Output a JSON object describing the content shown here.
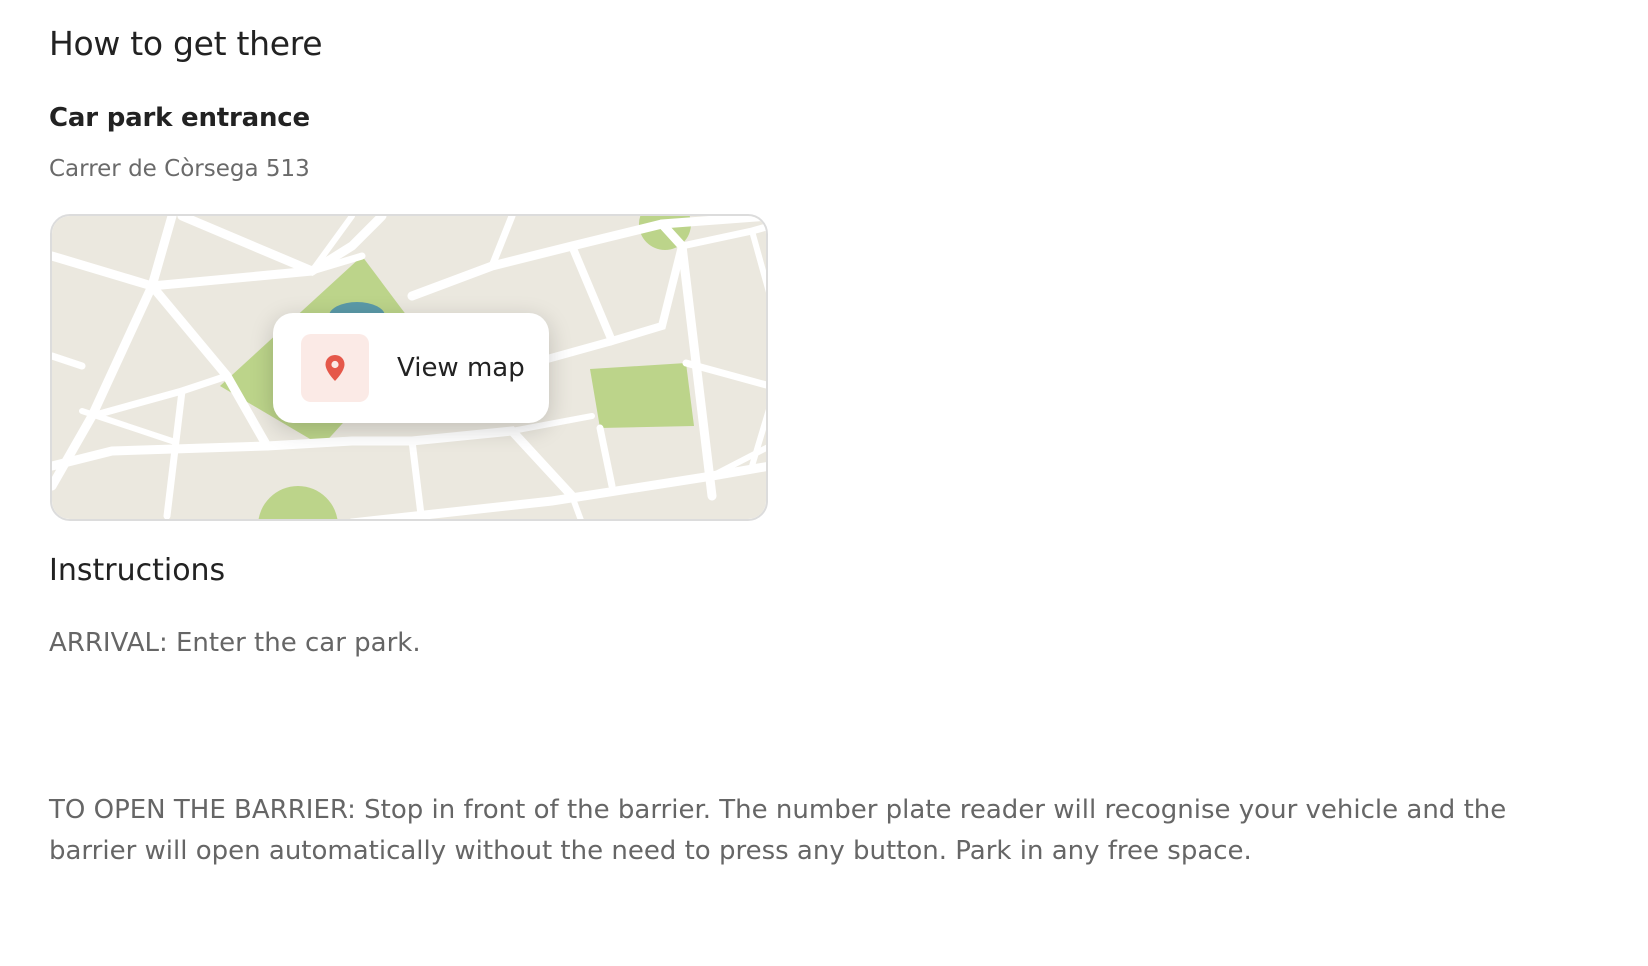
{
  "section": {
    "title": "How to get there"
  },
  "location": {
    "name": "Car park entrance",
    "address": "Carrer de Còrsega 513"
  },
  "map": {
    "button_label": "View map",
    "pin_icon": "map-pin-icon",
    "colors": {
      "land": "#ebe8df",
      "roads": "#ffffff",
      "parks": "#bcd48a",
      "water": "#5b9aa8",
      "pin": "#e5584a",
      "pin_bg": "#fbeae6"
    }
  },
  "instructions": {
    "title": "Instructions",
    "arrival": "ARRIVAL: Enter the car park.",
    "barrier": "TO OPEN THE BARRIER: Stop in front of the barrier. The number plate reader will recognise your vehicle and the barrier will open automatically without the need to press any button. Park in any free space."
  }
}
